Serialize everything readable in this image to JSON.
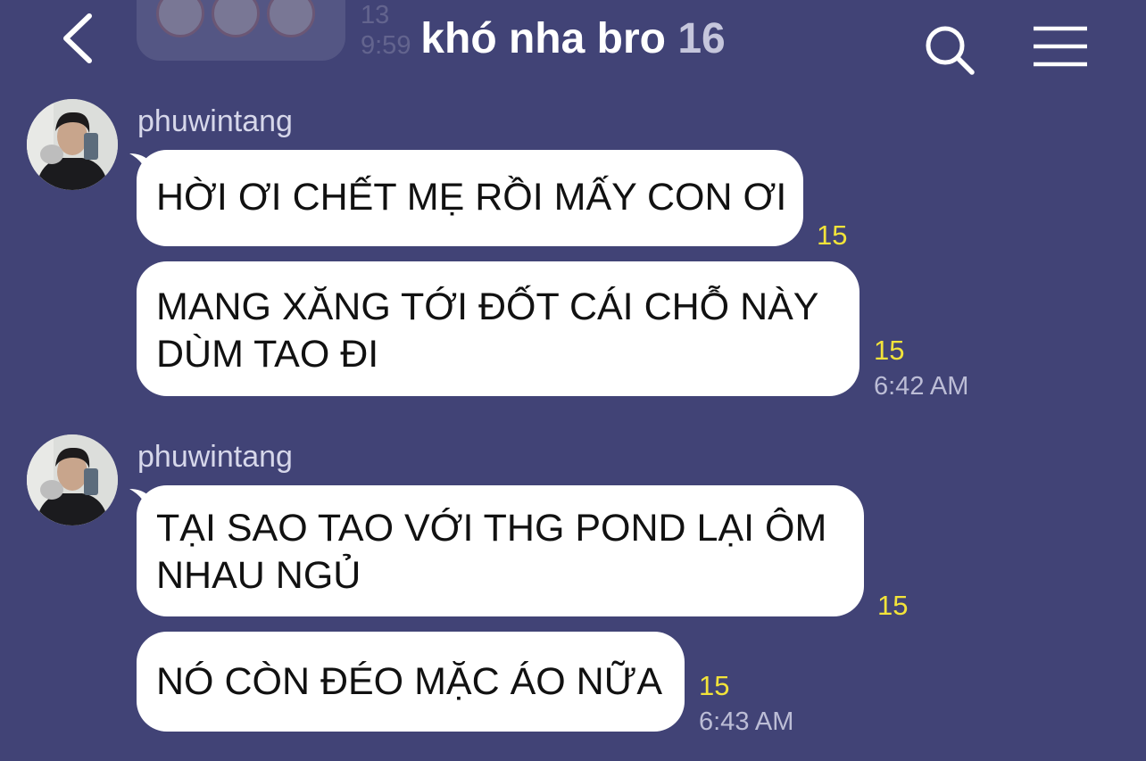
{
  "header": {
    "title": "khó nha bro",
    "member_count": "16"
  },
  "previous_message": {
    "read_count": "13",
    "time": "9:59"
  },
  "groups": [
    {
      "sender": "phuwintang",
      "messages": [
        {
          "text": "HỜI ƠI CHẾT MẸ RỒI MẤY CON ƠI",
          "read": "15"
        },
        {
          "text_line1": "MANG XĂNG TỚI ĐỐT CÁI CHỖ NÀY",
          "text_line2": "DÙM TAO ĐI",
          "read": "15",
          "time": "6:42 AM"
        }
      ]
    },
    {
      "sender": "phuwintang",
      "messages": [
        {
          "text_line1": "TẠI SAO TAO VỚI THG POND LẠI ÔM",
          "text_line2": "NHAU NGỦ",
          "read": "15"
        },
        {
          "text": "NÓ CÒN ĐÉO MẶC ÁO NỮA",
          "read": "15",
          "time": "6:43 AM"
        }
      ]
    }
  ],
  "colors": {
    "background": "#414376",
    "bubble": "#ffffff",
    "read_count": "#f2e33a",
    "timestamp": "#bcbdd6"
  },
  "icons": [
    "back-chevron-icon",
    "search-icon",
    "hamburger-menu-icon"
  ]
}
